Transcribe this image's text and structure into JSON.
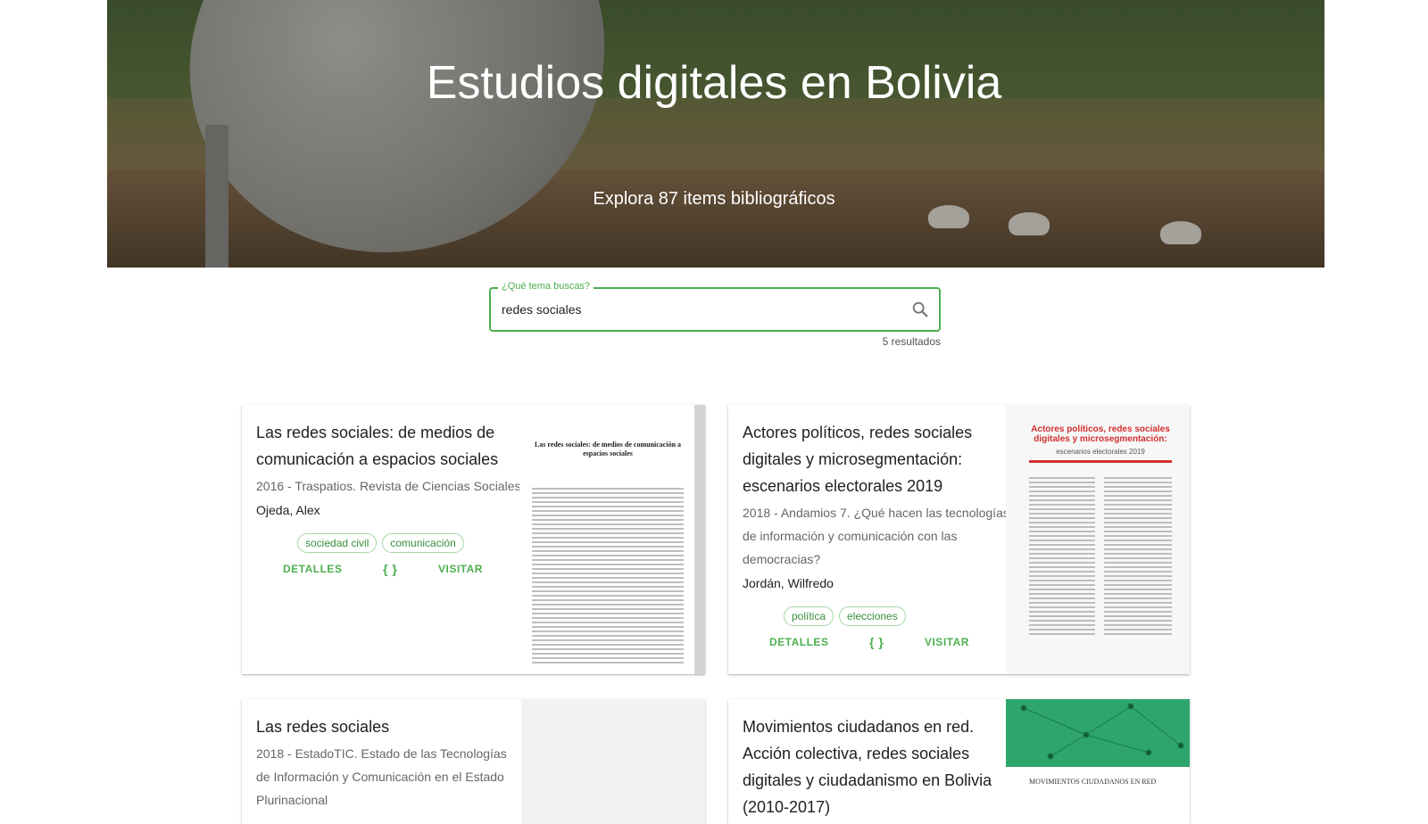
{
  "hero": {
    "title": "Estudios digitales en Bolivia",
    "subtitle": "Explora 87 items bibliográficos"
  },
  "search": {
    "label": "¿Qué tema buscas?",
    "value": "redes sociales",
    "results": "5 resultados"
  },
  "cards": [
    {
      "title": "Las redes sociales: de medios de comunicación a espacios sociales",
      "meta": "2016 - Traspatios. Revista de Ciencias Sociales",
      "author": "Ojeda, Alex",
      "tags": [
        "sociedad civil",
        "comunicación"
      ],
      "details": "DETALLES",
      "cite": "{ }",
      "visit": "VISITAR",
      "thumb_title": "Las redes sociales: de medios de comunicación a espacios sociales"
    },
    {
      "title": "Actores políticos, redes sociales digitales y microsegmentación: escenarios electorales 2019",
      "meta": "2018 - Andamios 7. ¿Qué hacen las tecnologías de información y comunicación con las democracias?",
      "author": "Jordán, Wilfredo",
      "tags": [
        "política",
        "elecciones"
      ],
      "details": "DETALLES",
      "cite": "{ }",
      "visit": "VISITAR",
      "thumb_title": "Actores políticos, redes sociales digitales y microsegmentación:",
      "thumb_subtitle": "escenarios electorales 2019"
    },
    {
      "title": "Las redes sociales",
      "meta": "2018 - EstadoTIC. Estado de las Tecnologías de Información y Comunicación en el Estado Plurinacional"
    },
    {
      "title": "Movimientos ciudadanos en red. Acción colectiva, redes sociales digitales y ciudadanismo en Bolivia (2010-2017)",
      "thumb_title": "MOVIMIENTOS CIUDADANOS EN RED"
    }
  ],
  "colors": {
    "accent": "#4caf50",
    "thumb_red": "#d32f2f",
    "thumb_green": "#2ea66b"
  }
}
